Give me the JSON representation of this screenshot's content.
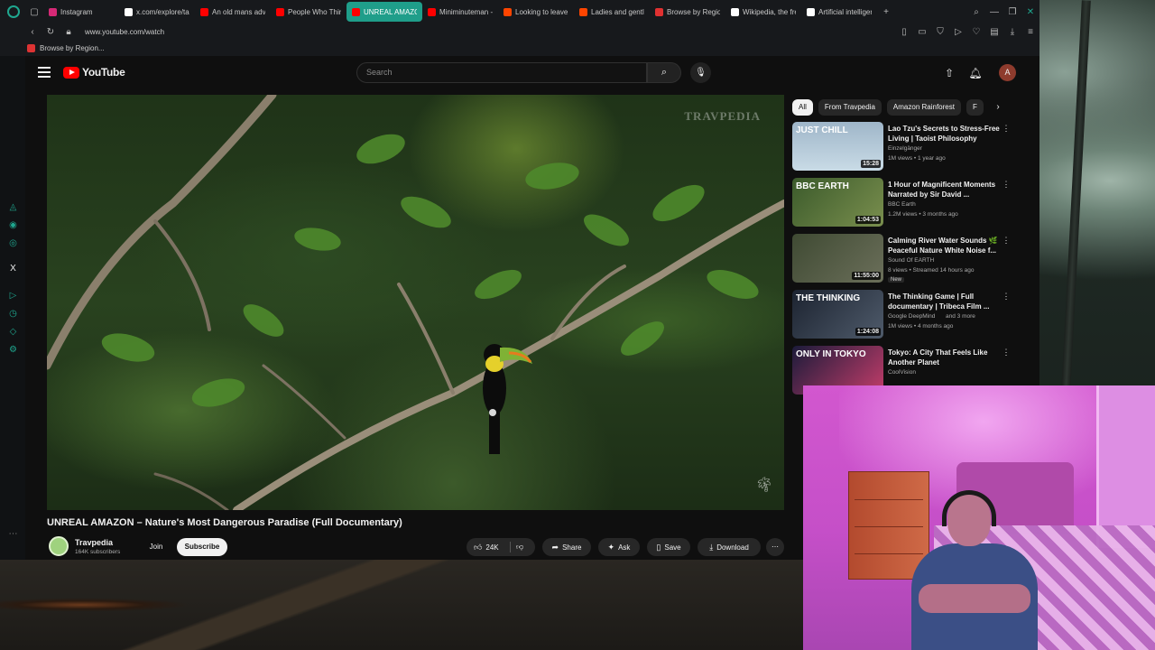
{
  "browser": {
    "tabs": [
      {
        "label": "Instagram",
        "color": "#d62976",
        "active": false
      },
      {
        "label": "x.com/explore/tab",
        "color": "#ffffff",
        "active": false
      },
      {
        "label": "An old mans advic",
        "color": "#ff0000",
        "active": false
      },
      {
        "label": "People Who Think",
        "color": "#ff0000",
        "active": false
      },
      {
        "label": "UNREAL AMAZON – N",
        "color": "#ff0000",
        "active": true
      },
      {
        "label": "Miniminuteman - T",
        "color": "#ff0000",
        "active": false
      },
      {
        "label": "Looking to leave t",
        "color": "#ff4500",
        "active": false
      },
      {
        "label": "Ladies and gentle",
        "color": "#ff4500",
        "active": false
      },
      {
        "label": "Browse by Region",
        "color": "#e03131",
        "active": false
      },
      {
        "label": "Wikipedia, the free",
        "color": "#ffffff",
        "active": false
      },
      {
        "label": "Artificial intelligen",
        "color": "#ffffff",
        "active": false
      }
    ],
    "new_tab_icon": "+",
    "url": "www.youtube.com/watch",
    "bookmark": "Browse by Region...",
    "accent_color": "#1fa78f"
  },
  "youtube": {
    "search_placeholder": "Search",
    "avatar_letter": "A",
    "video": {
      "watermark": "TRAVPEDIA",
      "title": "UNREAL AMAZON – Nature's Most Dangerous Paradise (Full Documentary)",
      "channel": "Travpedia",
      "subscribers": "164K subscribers",
      "join_label": "Join",
      "subscribe_label": "Subscribe",
      "likes": "24K",
      "share_label": "Share",
      "ask_label": "Ask",
      "save_label": "Save",
      "download_label": "Download"
    },
    "chips": [
      "All",
      "From Travpedia",
      "Amazon Rainforest",
      "F"
    ],
    "recommendations": [
      {
        "title": "Lao Tzu's Secrets to Stress-Free Living | Taoist Philosophy",
        "channel": "Einzelgänger",
        "meta": "1M views • 1 year ago",
        "duration": "15:28",
        "thumb_text": "JUST CHILL",
        "badge": ""
      },
      {
        "title": "1 Hour of Magnificent Moments Narrated by Sir David ...",
        "channel": "BBC Earth",
        "meta": "1.2M views • 3 months ago",
        "duration": "1:04:53",
        "thumb_text": "BBC EARTH",
        "badge": ""
      },
      {
        "title": "Calming River Water Sounds 🌿 Peaceful Nature White Noise f...",
        "channel": "Sound Of EARTH",
        "meta": "8 views • Streamed 14 hours ago",
        "duration": "11:55:00",
        "thumb_text": "",
        "badge": "New"
      },
      {
        "title": "The Thinking Game | Full documentary | Tribeca Film ...",
        "channel": "Google DeepMind",
        "channel_extra": "and 3 more",
        "meta": "1M views • 4 months ago",
        "duration": "1:24:08",
        "thumb_text": "THE THINKING",
        "badge": ""
      },
      {
        "title": "Tokyo: A City That Feels Like Another Planet",
        "channel": "CoolVision",
        "meta": "",
        "duration": "",
        "thumb_text": "ONLY IN TOKYO",
        "badge": ""
      }
    ]
  }
}
